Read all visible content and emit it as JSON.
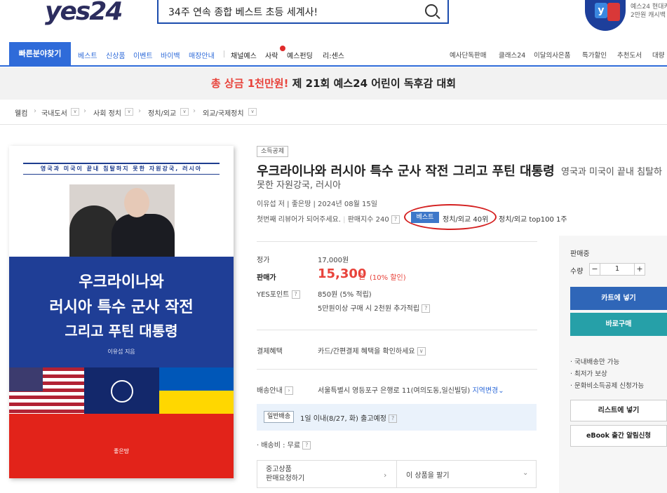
{
  "header": {
    "logo": "yes24",
    "search_value": "34주 연속 종합 베스트 초등 세계사!",
    "promo_line1": "예스24 현대카",
    "promo_line2": "2만원 캐시백"
  },
  "nav": {
    "category_button": "빠른분야찾기",
    "links": [
      "베스트",
      "신상품",
      "이벤트",
      "바이백",
      "매장안내"
    ],
    "links2": [
      "채널예스",
      "사락",
      "예스펀딩",
      "리:센스"
    ],
    "right_links": [
      "예사단독판매",
      "클래스24",
      "이달의사은품",
      "특가할인",
      "추천도서",
      "대량"
    ]
  },
  "banner": {
    "highlight": "총 상금 1천만원!",
    "text": " 제 21회 예스24 어린이 독후감 대회"
  },
  "breadcrumb": {
    "items": [
      "웰컴",
      "국내도서",
      "사회 정치",
      "정치/외교",
      "외교/국제정치"
    ]
  },
  "cover": {
    "subtitle": "영국과 미국이 끝내 침탈하지 못한 자원강국, 러시아",
    "title_line1": "우크라이나와",
    "title_line2": "러시아 특수 군사 작전",
    "title_line3": "그리고 푸틴 대통령",
    "author": "이유섭 지음",
    "publisher": "좋은땅"
  },
  "product": {
    "category_badge": "소득공제",
    "title": "우크라이나와 러시아 특수 군사 작전 그리고 푸틴 대통령",
    "subtitle_part1": "영국과 미국이 끝내 침탈하",
    "subtitle_part2": "못한 자원강국, 러시아",
    "meta": "이유섭 저  |  좋은땅  |  2024년 08월 15일",
    "review_prompt": "첫번째 리뷰어가 되어주세요.",
    "sales_index": "판매지수 240",
    "best_badge": "베스트",
    "best_rank": "정치/외교 40위",
    "best_rank2": "정치/외교 top100 1주"
  },
  "pricing": {
    "list_price_label": "정가",
    "list_price": "17,000원",
    "sale_price_label": "판매가",
    "sale_price": "15,300",
    "sale_unit": "원",
    "discount": "(10% 할인)",
    "points_label": "YES포인트",
    "points": "850원 (5% 적립)",
    "points_extra": "5만원이상 구매 시 2천원 추가적립"
  },
  "payment": {
    "label": "결제혜택",
    "text": "카드/간편결제 혜택을 확인하세요"
  },
  "shipping": {
    "label": "배송안내",
    "address": "서울특별시 영등포구 은행로 11(여의도동,일신빌딩)",
    "change_region": "지역변경",
    "type_badge": "일반배송",
    "eta": "1일 이내(8/27, 화) 출고예정",
    "fee": "배송비 : 무료"
  },
  "used": {
    "left_line1": "중고상품",
    "left_line2": "판매요청하기",
    "right": "이 상품을 팔기"
  },
  "side_panel": {
    "state": "판매중",
    "qty_label": "수량",
    "qty_value": "1",
    "cart_button": "카트에 넣기",
    "buy_button": "바로구매",
    "notes": [
      "국내배송만 가능",
      "최저가 보상",
      "문화비소득공제 신청가능"
    ],
    "list_button": "리스트에 넣기",
    "ebook_button": "eBook 출간 알림신청"
  }
}
